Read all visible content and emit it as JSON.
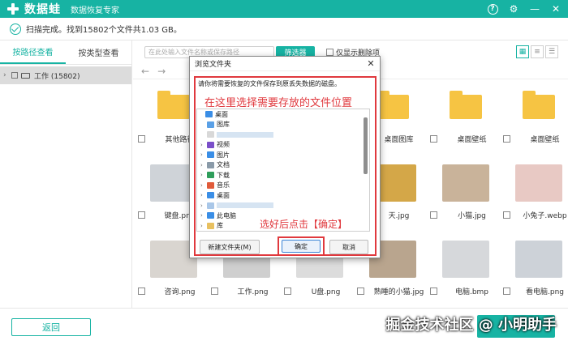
{
  "app": {
    "title": "数据蛙",
    "subtitle": "数据恢复专家"
  },
  "window_buttons": {
    "help": "?",
    "settings": "⚙",
    "minimize": "—",
    "close": "✕"
  },
  "status": {
    "text": "扫描完成。找到15802个文件共1.03 GB。"
  },
  "left": {
    "tabs": [
      {
        "label": "按路径查看"
      },
      {
        "label": "按类型查看"
      }
    ],
    "tree": {
      "label": "工作 (15802)"
    }
  },
  "toolbar": {
    "search_placeholder": "在此处输入文件名称或保存路径",
    "filter_label": "筛选器",
    "only_deleted_label": "仅显示删除项"
  },
  "files": [
    {
      "name": "其他路径",
      "kind": "folder"
    },
    {
      "name": "",
      "kind": "folder"
    },
    {
      "name": "",
      "kind": "folder"
    },
    {
      "name": "桌面图库",
      "kind": "folder"
    },
    {
      "name": "桌面壁纸",
      "kind": "folder"
    },
    {
      "name": "桌面壁纸",
      "kind": "folder"
    },
    {
      "name": "键盘.png",
      "kind": "photo",
      "color": "#cfd3d8"
    },
    {
      "name": "",
      "kind": "photo",
      "color": "#e5e5e5"
    },
    {
      "name": "",
      "kind": "photo",
      "color": "#e5e5e5"
    },
    {
      "name": "天.jpg",
      "kind": "photo",
      "color": "#d4a748"
    },
    {
      "name": "小猫.jpg",
      "kind": "photo",
      "color": "#c9b39a"
    },
    {
      "name": "小兔子.webp",
      "kind": "photo",
      "color": "#e8c9c4"
    },
    {
      "name": "咨询.png",
      "kind": "photo",
      "color": "#d9d5d0"
    },
    {
      "name": "工作.png",
      "kind": "photo",
      "color": "#cfcfcf"
    },
    {
      "name": "U盘.png",
      "kind": "photo",
      "color": "#dcdcdc"
    },
    {
      "name": "熟睡的小猫.jpg",
      "kind": "photo",
      "color": "#b9a58e"
    },
    {
      "name": "电脑.bmp",
      "kind": "photo",
      "color": "#d6d8db"
    },
    {
      "name": "看电脑.png",
      "kind": "photo",
      "color": "#cdd2d8"
    }
  ],
  "footer": {
    "back_label": "返回",
    "watermark": "掘金技术社区 @ 小明助手"
  },
  "dialog": {
    "title": "浏览文件夹",
    "close": "✕",
    "description": "请你将需要恢复的文件保存到原丢失数据的磁盘。",
    "hint_top": "在这里选择需要存放的文件位置",
    "hint_bottom": "选好后点击【确定】",
    "tree": [
      {
        "label": "桌面",
        "arrow": "",
        "color": "#3a8ee6",
        "indent": 0
      },
      {
        "label": "图库",
        "arrow": "",
        "color": "#5aa0e6",
        "indent": 1
      },
      {
        "label": "",
        "arrow": "",
        "color": "#d8d8d8",
        "indent": 1
      },
      {
        "label": "视频",
        "arrow": "›",
        "color": "#7a4fc9",
        "indent": 1
      },
      {
        "label": "图片",
        "arrow": "›",
        "color": "#3a8ee6",
        "indent": 1
      },
      {
        "label": "文档",
        "arrow": "›",
        "color": "#8a9aa8",
        "indent": 1
      },
      {
        "label": "下载",
        "arrow": "›",
        "color": "#2f9e5b",
        "indent": 1
      },
      {
        "label": "音乐",
        "arrow": "›",
        "color": "#e05b3a",
        "indent": 1
      },
      {
        "label": "桌面",
        "arrow": "›",
        "color": "#3a8ee6",
        "indent": 1
      },
      {
        "label": "",
        "arrow": "›",
        "color": "#a9c7e8",
        "indent": 1
      },
      {
        "label": "此电脑",
        "arrow": "›",
        "color": "#3a8ee6",
        "indent": 1
      },
      {
        "label": "库",
        "arrow": "›",
        "color": "#e8c060",
        "indent": 1
      }
    ],
    "new_folder_label": "新建文件夹(M)",
    "ok_label": "确定",
    "cancel_label": "取消"
  }
}
